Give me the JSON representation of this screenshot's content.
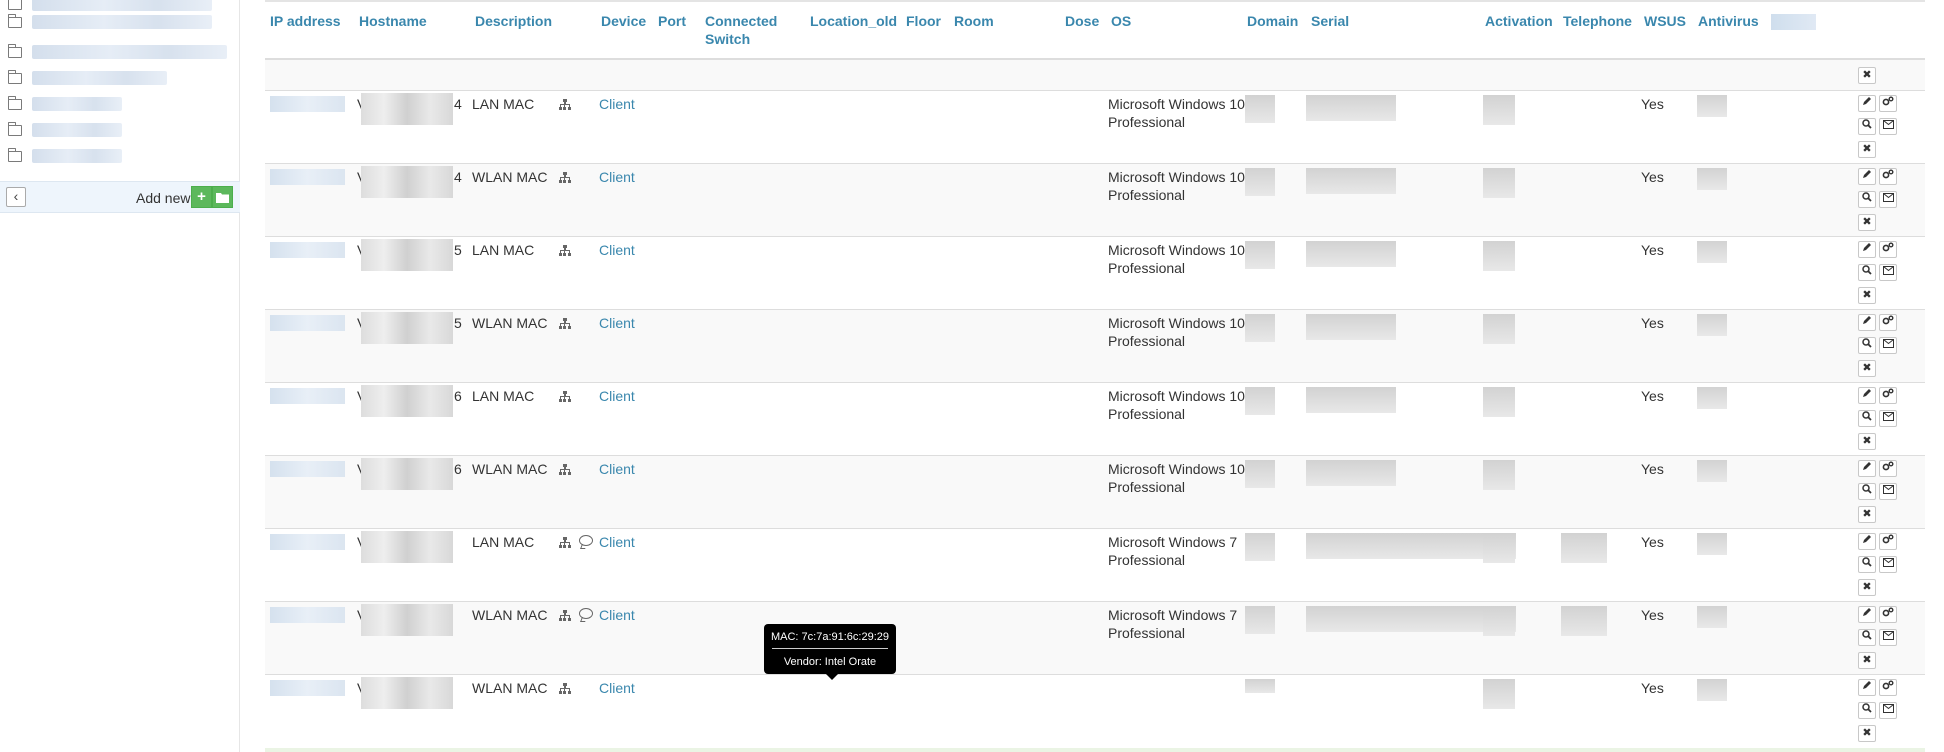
{
  "sidebar": {
    "add_new_label": "Add new",
    "add_button_symbol": "+",
    "collapse_symbol": "‹"
  },
  "table": {
    "headers": {
      "ip": "IP address",
      "hostname": "Hostname",
      "description": "Description",
      "device": "Device",
      "port": "Port",
      "connected_switch": "Connected Switch",
      "location_old": "Location_old",
      "floor": "Floor",
      "room": "Room",
      "dose": "Dose",
      "os": "OS",
      "domain": "Domain",
      "serial": "Serial",
      "activation": "Activation",
      "telephone": "Telephone",
      "wsus": "WSUS",
      "antivirus": "Antivirus"
    },
    "rows": [
      {
        "host_prefix": "V",
        "host_suffix": "4",
        "description": "LAN MAC",
        "device": "Client",
        "os": "Microsoft Windows 10 Professional",
        "wsus": "Yes",
        "comment": false
      },
      {
        "host_prefix": "V",
        "host_suffix": "4",
        "description": "WLAN MAC",
        "device": "Client",
        "os": "Microsoft Windows 10 Professional",
        "wsus": "Yes",
        "comment": false
      },
      {
        "host_prefix": "V",
        "host_suffix": "5",
        "description": "LAN MAC",
        "device": "Client",
        "os": "Microsoft Windows 10 Professional",
        "wsus": "Yes",
        "comment": false
      },
      {
        "host_prefix": "V",
        "host_suffix": "5",
        "description": "WLAN MAC",
        "device": "Client",
        "os": "Microsoft Windows 10 Professional",
        "wsus": "Yes",
        "comment": false
      },
      {
        "host_prefix": "V",
        "host_suffix": "6",
        "description": "LAN MAC",
        "device": "Client",
        "os": "Microsoft Windows 10 Professional",
        "wsus": "Yes",
        "comment": false
      },
      {
        "host_prefix": "V",
        "host_suffix": "6",
        "description": "WLAN MAC",
        "device": "Client",
        "os": "Microsoft Windows 10 Professional",
        "wsus": "Yes",
        "comment": false
      },
      {
        "host_prefix": "V",
        "host_suffix": "",
        "description": "LAN MAC",
        "device": "Client",
        "os": "Microsoft Windows 7 Professional",
        "wsus": "Yes",
        "comment": true
      },
      {
        "host_prefix": "V",
        "host_suffix": "",
        "description": "WLAN MAC",
        "device": "Client",
        "os": "Microsoft Windows 7 Professional",
        "wsus": "Yes",
        "comment": true
      },
      {
        "host_prefix": "V",
        "host_suffix": "",
        "description": "WLAN MAC",
        "device": "Client",
        "os": "",
        "wsus": "Yes",
        "comment": false
      }
    ]
  },
  "tooltip": {
    "mac": "MAC: 7c:7a:91:6c:29:29",
    "vendor": "Vendor: Intel Orate"
  },
  "icons": {
    "folder": "folder-icon",
    "network": "network-icon",
    "comment": "comment-icon",
    "edit": "pencil-icon",
    "settings": "gears-icon",
    "search": "search-icon",
    "mail": "mail-icon",
    "delete": "close-icon"
  },
  "colors": {
    "link": "#3a87ad",
    "add_button": "#5cb85c"
  }
}
